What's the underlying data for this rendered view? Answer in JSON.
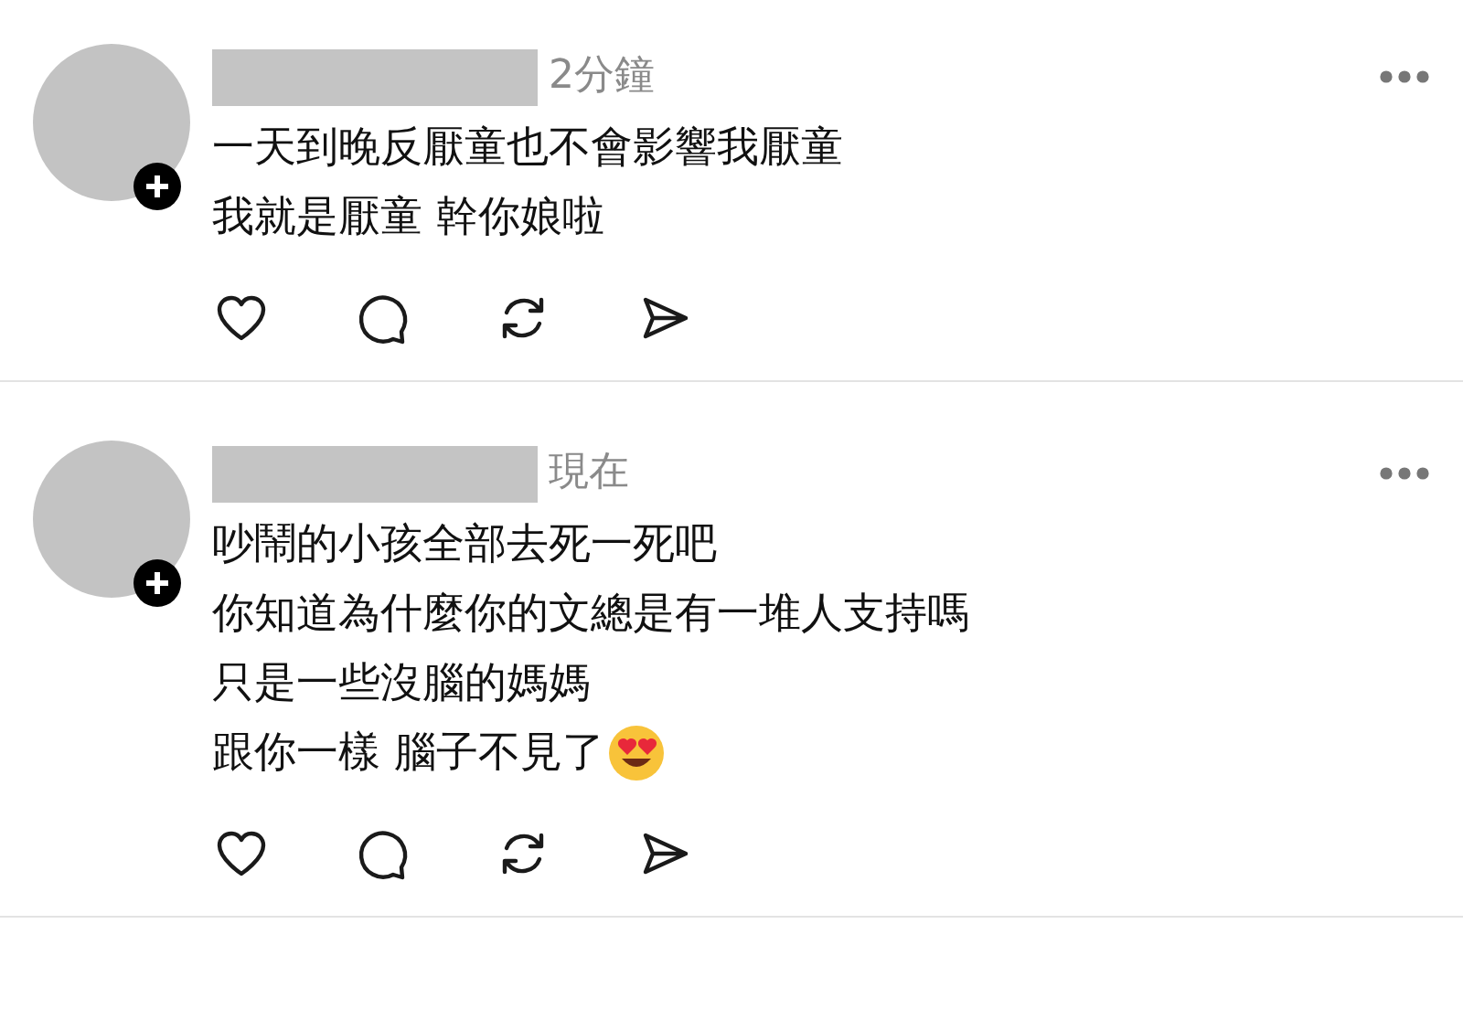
{
  "posts": [
    {
      "name_redacted": true,
      "time": "2分鐘",
      "has_follow_badge": true,
      "lines": [
        {
          "text": "一天到晚反厭童也不會影響我厭童"
        },
        {
          "text": "我就是厭童 幹你娘啦"
        }
      ]
    },
    {
      "name_redacted": true,
      "time": "現在",
      "has_follow_badge": true,
      "lines": [
        {
          "text": "吵鬧的小孩全部去死一死吧"
        },
        {
          "text": "你知道為什麼你的文總是有一堆人支持嗎"
        },
        {
          "text": "只是一些沒腦的媽媽"
        },
        {
          "text": "跟你一樣 腦子不見了",
          "emoji": true
        }
      ]
    }
  ]
}
